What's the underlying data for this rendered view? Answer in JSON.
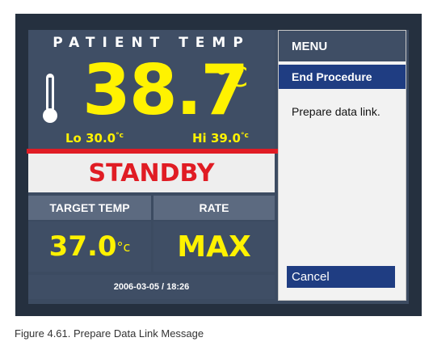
{
  "patient_temp": {
    "title": "PATIENT TEMP",
    "value": "38.7",
    "unit": "°C",
    "lo_label": "Lo",
    "lo_value": "30.0",
    "lo_unit": "°c",
    "hi_label": "Hi",
    "hi_value": "39.0",
    "hi_unit": "°c"
  },
  "status": "STANDBY",
  "target": {
    "header": "TARGET TEMP",
    "value": "37.0",
    "unit": "°c"
  },
  "rate": {
    "header": "RATE",
    "value": "MAX"
  },
  "datetime": "2006-03-05 / 18:26",
  "menu": {
    "title": "MENU",
    "selected_item": "End Procedure",
    "message": "Prepare data link.",
    "cancel_label": "Cancel"
  },
  "caption": "Figure 4.61. Prepare Data Link Message",
  "colors": {
    "accent_yellow": "#fff200",
    "alert_red": "#e01c24",
    "panel_blue": "#3f4e65",
    "selection_blue": "#1f3d82"
  }
}
